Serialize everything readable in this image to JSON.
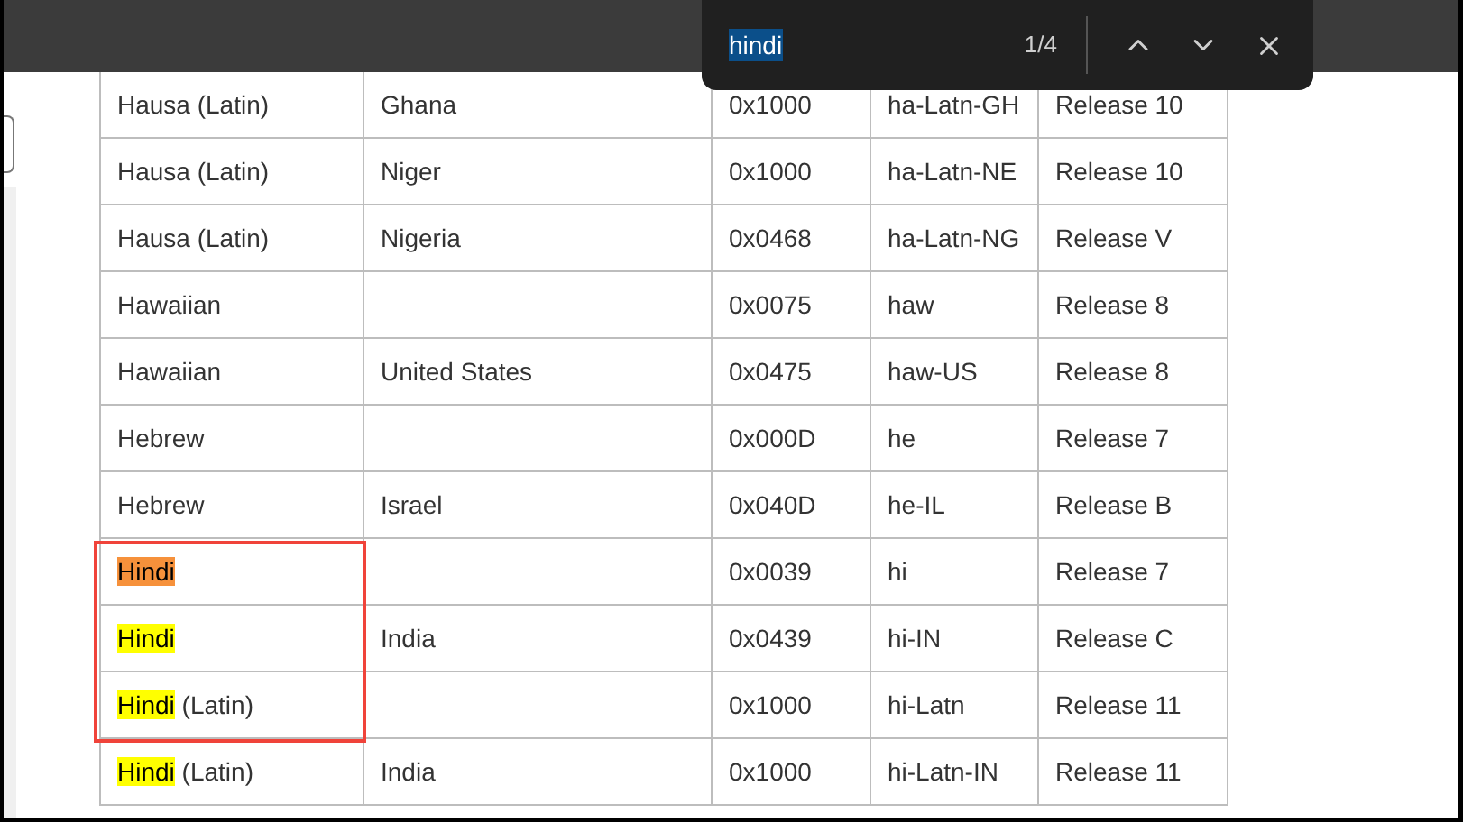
{
  "find_bar": {
    "query": "hindi",
    "count": "1/4"
  },
  "table": {
    "rows": [
      {
        "cells": [
          {
            "text": "Hausa (Latin)"
          },
          {
            "text": "Ghana"
          },
          {
            "text": "0x1000"
          },
          {
            "text": "ha-Latn-GH"
          },
          {
            "text": "Release 10"
          }
        ],
        "boxed": false
      },
      {
        "cells": [
          {
            "text": "Hausa (Latin)"
          },
          {
            "text": "Niger"
          },
          {
            "text": "0x1000"
          },
          {
            "text": "ha-Latn-NE"
          },
          {
            "text": "Release 10"
          }
        ],
        "boxed": false
      },
      {
        "cells": [
          {
            "text": "Hausa (Latin)"
          },
          {
            "text": "Nigeria"
          },
          {
            "text": "0x0468"
          },
          {
            "text": "ha-Latn-NG"
          },
          {
            "text": "Release V"
          }
        ],
        "boxed": false
      },
      {
        "cells": [
          {
            "text": "Hawaiian"
          },
          {
            "text": ""
          },
          {
            "text": "0x0075"
          },
          {
            "text": "haw"
          },
          {
            "text": "Release 8"
          }
        ],
        "boxed": false
      },
      {
        "cells": [
          {
            "text": "Hawaiian"
          },
          {
            "text": "United States"
          },
          {
            "text": "0x0475"
          },
          {
            "text": "haw-US"
          },
          {
            "text": "Release 8"
          }
        ],
        "boxed": false
      },
      {
        "cells": [
          {
            "text": "Hebrew"
          },
          {
            "text": ""
          },
          {
            "text": "0x000D"
          },
          {
            "text": "he"
          },
          {
            "text": "Release 7"
          }
        ],
        "boxed": false
      },
      {
        "cells": [
          {
            "text": "Hebrew"
          },
          {
            "text": "Israel"
          },
          {
            "text": "0x040D"
          },
          {
            "text": "he-IL"
          },
          {
            "text": "Release B"
          }
        ],
        "boxed": false
      },
      {
        "cells": [
          {
            "match": "Hindi",
            "current": true,
            "text": ""
          },
          {
            "text": ""
          },
          {
            "text": "0x0039"
          },
          {
            "text": "hi"
          },
          {
            "text": "Release 7"
          }
        ],
        "boxed": true
      },
      {
        "cells": [
          {
            "match": "Hindi",
            "current": false,
            "text": ""
          },
          {
            "text": "India"
          },
          {
            "text": "0x0439"
          },
          {
            "text": "hi-IN"
          },
          {
            "text": "Release C"
          }
        ],
        "boxed": true
      },
      {
        "cells": [
          {
            "match": "Hindi",
            "current": false,
            "text": " (Latin)"
          },
          {
            "text": ""
          },
          {
            "text": "0x1000"
          },
          {
            "text": "hi-Latn"
          },
          {
            "text": "Release 11"
          }
        ],
        "boxed": true
      },
      {
        "cells": [
          {
            "match": "Hindi",
            "current": false,
            "text": " (Latin)"
          },
          {
            "text": "India"
          },
          {
            "text": "0x1000"
          },
          {
            "text": "hi-Latn-IN"
          },
          {
            "text": "Release 11"
          }
        ],
        "boxed": false
      }
    ]
  }
}
